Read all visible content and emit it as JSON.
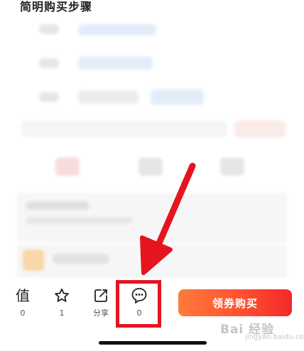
{
  "section": {
    "title": "简明购买步骤"
  },
  "actions": [
    {
      "name": "worth",
      "icon": "值",
      "count": "0"
    },
    {
      "name": "favorite",
      "icon": "star-icon",
      "count": "1"
    },
    {
      "name": "share",
      "icon": "share-icon",
      "label": "分享"
    },
    {
      "name": "comment",
      "icon": "comment-icon",
      "count": "0"
    }
  ],
  "buy_button": {
    "label": "领券购买"
  },
  "watermark": {
    "text": "Bai 经验",
    "sub": "jingyan.baidu.com"
  },
  "colors": {
    "accent": "#f2282a",
    "annotation": "#e5141f"
  }
}
